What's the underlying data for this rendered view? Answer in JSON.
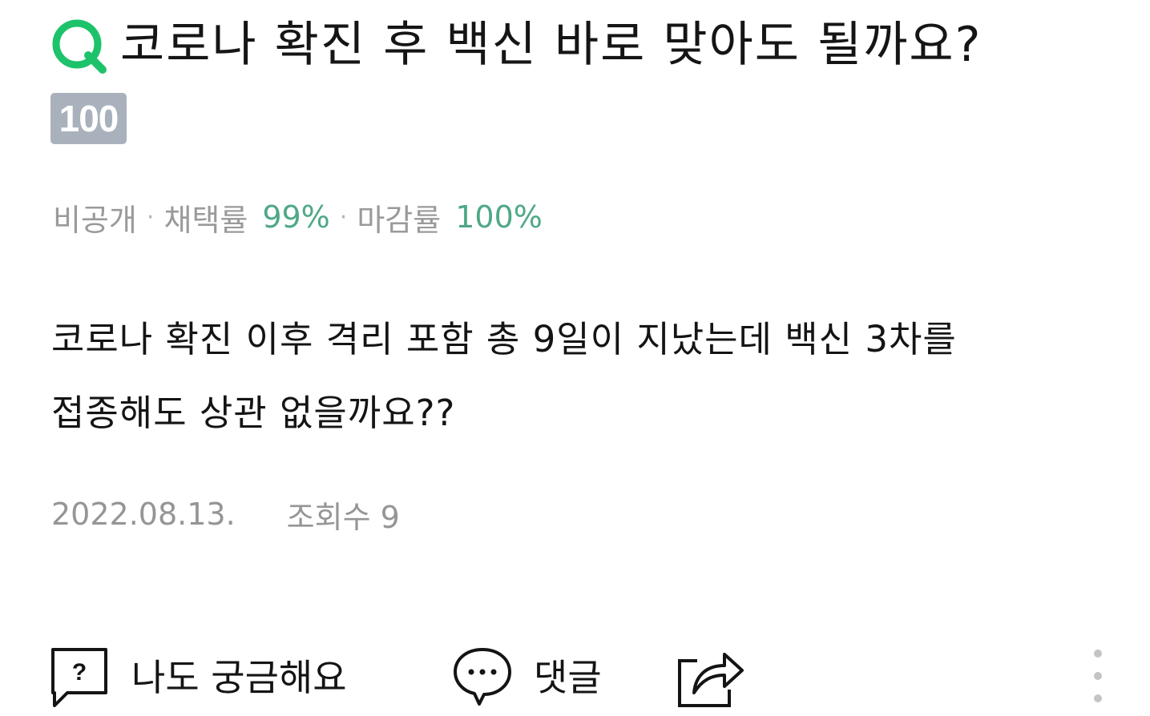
{
  "question": {
    "title": "코로나 확진 후 백신 바로 맞아도 될까요?",
    "points": "100",
    "icon": "q-icon",
    "accent_color": "#1ec26b"
  },
  "meta": {
    "visibility": "비공개",
    "adoption_label": "채택률",
    "adoption_value": "99%",
    "close_label": "마감률",
    "close_value": "100%",
    "value_color": "#4fa886"
  },
  "body": {
    "line1": "코로나 확진 이후 격리 포함 총 9일이 지났는데 백신 3차를",
    "line2": "접종해도 상관 없을까요??"
  },
  "info": {
    "date": "2022.08.13.",
    "views_label": "조회수",
    "views_count": "9"
  },
  "actions": {
    "curious_label": "나도 궁금해요",
    "curious_icon": "question-bubble-icon",
    "comment_label": "댓글",
    "comment_icon": "speech-bubble-icon",
    "share_icon": "share-icon",
    "more_icon": "more-vertical-icon"
  }
}
